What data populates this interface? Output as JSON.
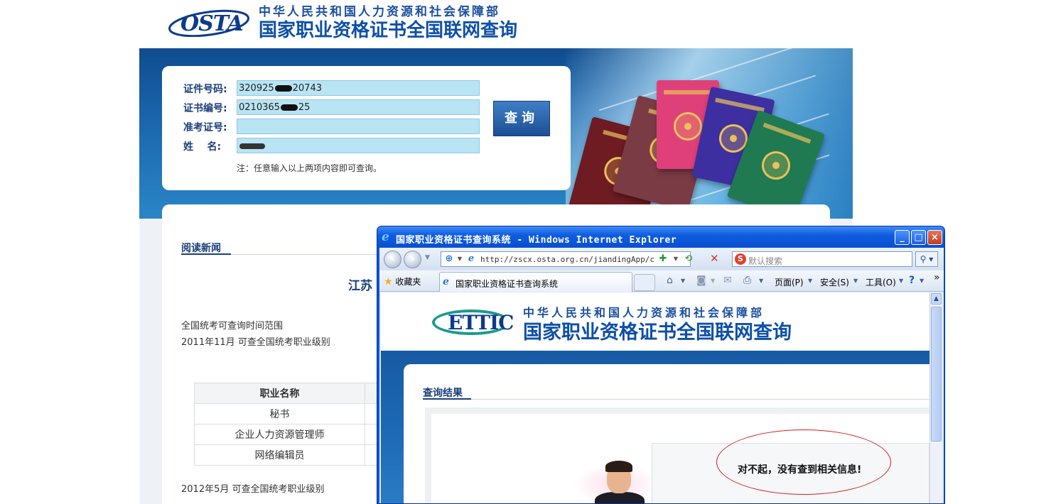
{
  "osta": {
    "logo_text": "OSTA",
    "ministry": "中华人民共和国人力资源和社会保障部",
    "site_title": "国家职业资格证书全国联网查询"
  },
  "login": {
    "id_label": "证件号码:",
    "id_prefix": "320925",
    "id_suffix": "20743",
    "cert_label": "证书编号:",
    "cert_prefix": "0210365",
    "cert_suffix": "25",
    "exam_label": "准考证号:",
    "exam_value": "",
    "name_label": "姓    名:",
    "query_button": "查询",
    "note": "注：任意输入以上两项内容即可查询。"
  },
  "news": {
    "heading": "阅读新闻",
    "title": "江苏",
    "para1": "全国统考可查询时间范围",
    "para2": "2011年11月  可查全国统考职业级别",
    "table_header": "职业名称",
    "jobs": [
      "秘书",
      "企业人力资源管理师",
      "网络编辑员"
    ],
    "para3": "2012年5月  可查全国统考职业级别"
  },
  "ie": {
    "window_title": "国家职业资格证书查询系统 - Windows Internet Explorer",
    "address": "http://zscx.osta.org.cn/jiandingApp/comm",
    "search_placeholder": "默认搜索",
    "favorites": "收藏夹",
    "tab_title": "国家职业资格证书查询系统",
    "page_menu": "页面(P)",
    "safety_menu": "安全(S)",
    "tools_menu": "工具(O)",
    "chevron": "»"
  },
  "result_page": {
    "logo_text": "ETTIC",
    "ministry": "中华人民共和国人力资源和社会保障部",
    "site_title": "国家职业资格证书全国联网查询",
    "heading": "查询结果",
    "message": "对不起，没有查到相关信息!"
  }
}
